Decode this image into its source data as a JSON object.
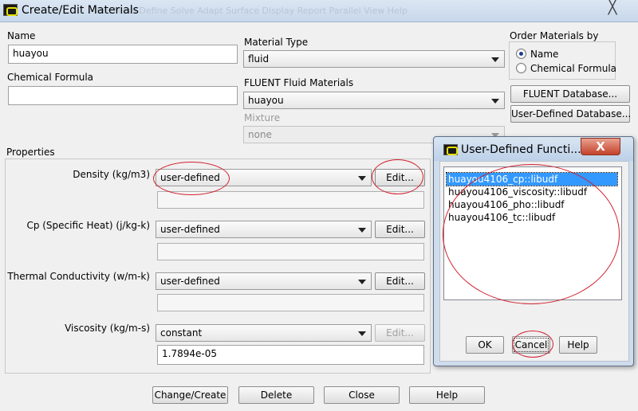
{
  "window": {
    "title": "Create/Edit Materials",
    "ghost_menu": "File  Mesh  Define  Solve  Adapt  Surface  Display  Report  Parallel  View  Help",
    "close_glyph": "╳"
  },
  "name": {
    "label": "Name",
    "value": "huayou"
  },
  "chemical_formula": {
    "label": "Chemical Formula",
    "value": ""
  },
  "material_type": {
    "label": "Material Type",
    "value": "fluid"
  },
  "fluent_fluid_materials": {
    "label": "FLUENT Fluid Materials",
    "value": "huayou"
  },
  "mixture": {
    "label": "Mixture",
    "value": "none"
  },
  "order_materials": {
    "label": "Order Materials by",
    "options": [
      {
        "label": "Name",
        "selected": true
      },
      {
        "label": "Chemical Formula",
        "selected": false
      }
    ]
  },
  "database_buttons": {
    "fluent": "FLUENT Database...",
    "user_defined": "User-Defined Database..."
  },
  "properties": {
    "label": "Properties",
    "rows": [
      {
        "label": "Density (kg/m3)",
        "method": "user-defined",
        "edit": "Edit...",
        "value": ""
      },
      {
        "label": "Cp (Specific Heat) (j/kg-k)",
        "method": "user-defined",
        "edit": "Edit...",
        "value": ""
      },
      {
        "label": "Thermal Conductivity (w/m-k)",
        "method": "user-defined",
        "edit": "Edit...",
        "value": ""
      },
      {
        "label": "Viscosity (kg/m-s)",
        "method": "constant",
        "edit": "Edit...",
        "value": "1.7894e-05"
      }
    ]
  },
  "bottom_buttons": {
    "change_create": "Change/Create",
    "delete": "Delete",
    "close": "Close",
    "help": "Help"
  },
  "udf_dialog": {
    "title": "User-Defined Functi...",
    "close_glyph": "X",
    "functions": [
      "huayou4106_cp::libudf",
      "huayou4106_viscosity::libudf",
      "huayou4106_pho::libudf",
      "huayou4106_tc::libudf"
    ],
    "selected_index": 0,
    "ok": "OK",
    "cancel": "Cancel",
    "help": "Help"
  },
  "colors": {
    "annotation_red": "#d2202e",
    "selection_blue": "#3399ff"
  }
}
